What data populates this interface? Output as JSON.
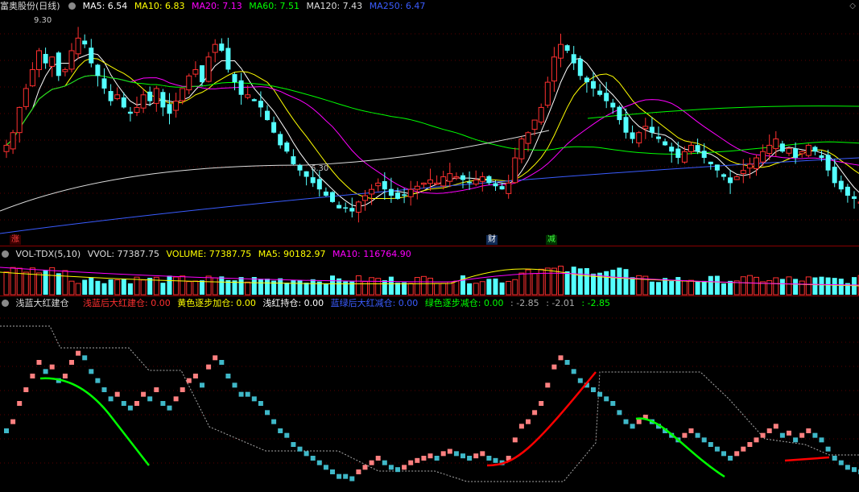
{
  "main": {
    "title": "富奥股份(日线)",
    "ma_labels": [
      {
        "text": "MA5: 6.54",
        "color": "#ffffff"
      },
      {
        "text": "MA10: 6.83",
        "color": "#ffff00"
      },
      {
        "text": "MA20: 7.13",
        "color": "#ff00ff"
      },
      {
        "text": "MA60: 7.51",
        "color": "#00ff00"
      },
      {
        "text": "MA120: 7.43",
        "color": "#dddddd"
      },
      {
        "text": "MA250: 6.47",
        "color": "#3a5cff"
      }
    ],
    "high_label": "9.30",
    "low_label": "6.30",
    "events": [
      {
        "text": "涨",
        "color": "#ff4040",
        "bg": "#3a0000"
      },
      {
        "text": "财",
        "color": "#ffffff",
        "bg": "#102a55"
      },
      {
        "text": "减",
        "color": "#40ff40",
        "bg": "#003300"
      }
    ]
  },
  "volume": {
    "title": "VOL-TDX(5,10)",
    "labels": [
      {
        "text": "VVOL: 77387.75",
        "color": "#dddddd"
      },
      {
        "text": "VOLUME: 77387.75",
        "color": "#ffff00"
      },
      {
        "text": "MA5: 90182.97",
        "color": "#ffff00"
      },
      {
        "text": "MA10: 116764.90",
        "color": "#ff00ff"
      }
    ]
  },
  "indicator": {
    "title": "浅蓝大红建仓",
    "labels": [
      {
        "text": "浅蓝后大红建仓: 0.00",
        "color": "#ff3030"
      },
      {
        "text": "黄色逐步加仓: 0.00",
        "color": "#ffff00"
      },
      {
        "text": "浅红持仓: 0.00",
        "color": "#ffffff"
      },
      {
        "text": "蓝绿后大红减仓: 0.00",
        "color": "#3a5cff"
      },
      {
        "text": "绿色逐步减仓: 0.00",
        "color": "#00ff00"
      },
      {
        "text": ": -2.85",
        "color": "#aaaaaa"
      },
      {
        "text": ": -2.01",
        "color": "#aaaaaa"
      },
      {
        "text": ": -2.85",
        "color": "#00ff00"
      }
    ]
  },
  "chart_data": {
    "type": "candlestick",
    "symbol": "富奥股份",
    "period": "日线",
    "price_range": [
      6.0,
      9.5
    ],
    "annotations": {
      "high": 9.3,
      "low": 6.3
    },
    "close": [
      7.4,
      7.6,
      8.0,
      8.3,
      8.6,
      8.9,
      8.7,
      8.8,
      8.5,
      8.6,
      8.9,
      9.1,
      9.0,
      8.7,
      8.5,
      8.3,
      8.1,
      8.2,
      8.0,
      7.9,
      8.0,
      8.2,
      8.1,
      8.3,
      8.0,
      7.9,
      8.1,
      8.3,
      8.5,
      8.6,
      8.4,
      8.8,
      9.0,
      8.9,
      8.6,
      8.4,
      8.2,
      8.2,
      8.1,
      8.0,
      7.8,
      7.6,
      7.4,
      7.3,
      7.1,
      7.0,
      6.9,
      6.8,
      6.7,
      6.6,
      6.5,
      6.4,
      6.4,
      6.35,
      6.5,
      6.6,
      6.7,
      6.8,
      6.7,
      6.6,
      6.55,
      6.6,
      6.7,
      6.75,
      6.8,
      6.85,
      6.8,
      6.9,
      6.95,
      6.9,
      6.85,
      6.8,
      6.85,
      6.9,
      6.8,
      6.75,
      6.7,
      6.8,
      7.2,
      7.5,
      7.6,
      7.8,
      8.0,
      8.4,
      8.8,
      9.0,
      8.9,
      8.7,
      8.5,
      8.4,
      8.3,
      8.2,
      8.1,
      8.0,
      7.8,
      7.6,
      7.5,
      7.6,
      7.7,
      7.6,
      7.5,
      7.4,
      7.3,
      7.2,
      7.3,
      7.4,
      7.3,
      7.2,
      7.1,
      7.0,
      6.9,
      6.8,
      6.9,
      7.0,
      7.1,
      7.2,
      7.3,
      7.4,
      7.5,
      7.3,
      7.35,
      7.2,
      7.3,
      7.4,
      7.3,
      7.2,
      7.0,
      6.8,
      6.7,
      6.6,
      6.55,
      6.5
    ]
  }
}
